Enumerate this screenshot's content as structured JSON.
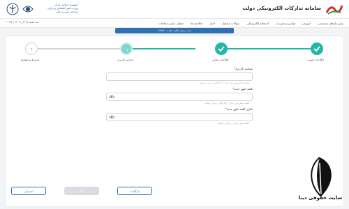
{
  "header": {
    "site_title": "سامانه تدارکات الکترونیکی دولت",
    "agency_line1": "جمهوری اسلامی ایران",
    "agency_line2": "وزارت امور اقتصادی و دارایی",
    "agency_line3": "سازمان مدیریت مالی"
  },
  "navbar": {
    "items": [
      "بیش نیازهای سیستمی",
      "آموزش",
      "قوانین و مقررات",
      "استعلام الکترونیکی",
      "سوالات متداول",
      "اخبار",
      "اطلاعیه ها",
      "شفاف سازی معاملات"
    ],
    "date": "سه شنبه ۱۷ آذر ۱۴۰۳ | ۱۰:۳۷"
  },
  "session": {
    "text": "مدت زمان باقی مانده : ۲۹:۵۶"
  },
  "steps": [
    {
      "label": "اطلاعات هویتی",
      "status": "done"
    },
    {
      "label": "اطلاعات تماس",
      "status": "done"
    },
    {
      "label": "شناسه کاربری",
      "status": "active",
      "number": "۳"
    },
    {
      "label": "شرایط و ضوابط",
      "status": "pending",
      "number": "۴"
    }
  ],
  "form": {
    "username_label": "شناسه کاربری*",
    "username_placeholder": "شناسه کاربری بین ۶ تا ۲۰ کاراکتر را وارد نمایید",
    "password_label": "کلمه عبور جدید*",
    "password_placeholder": "کلمه عبور بین ۸ تا ۲۰ کاراکتر را وارد نمایید",
    "confirm_label": "تکرار کلمه عبور جدید*",
    "confirm_placeholder": "کلمه عبور جدید را تکرار نمایید"
  },
  "buttons": {
    "cancel": "انصراف",
    "confirm": "تایید",
    "back": "بازگشت"
  },
  "watermark": {
    "text": "سایت حقوقی دینا"
  },
  "colors": {
    "accent": "#2f6fb3",
    "done": "#22b8a6",
    "active": "#7fd6cc",
    "pending": "#cfd4da"
  }
}
